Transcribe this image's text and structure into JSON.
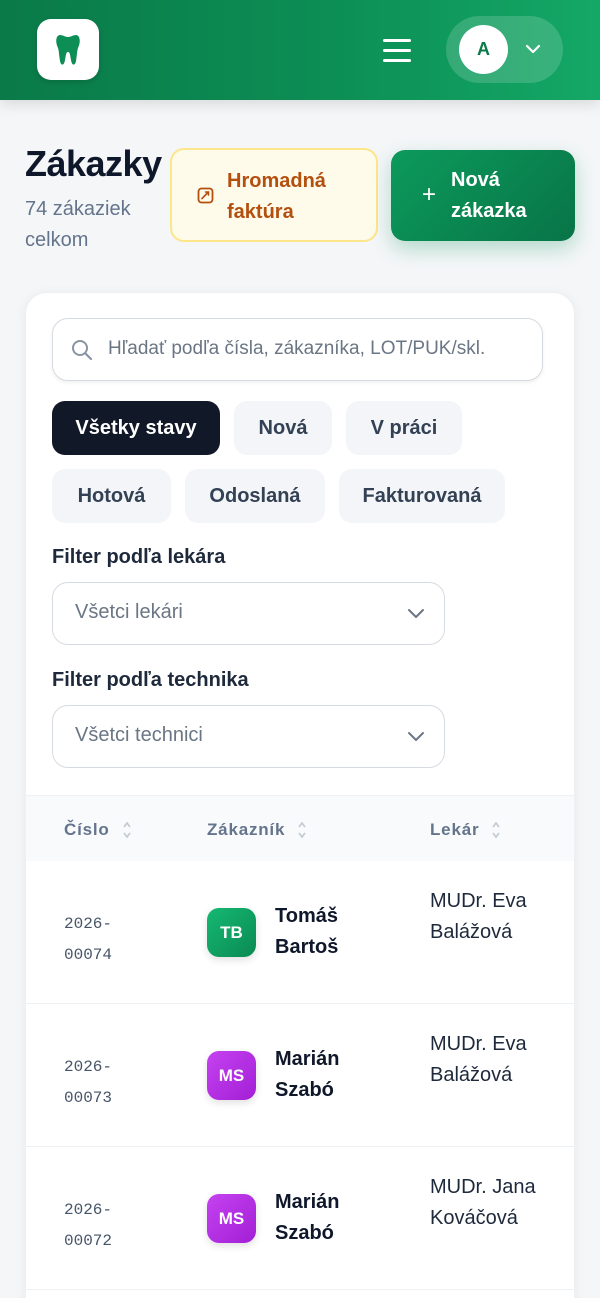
{
  "header": {
    "user_initial": "A",
    "brand_color": "#0c8e55"
  },
  "page": {
    "title": "Zákazky",
    "subtitle": "74 zákaziek celkom",
    "bulk_invoice_label": "Hromadná faktúra",
    "new_order_label": "Nová zákazka",
    "new_order_icon": "plus-icon",
    "bulk_invoice_icon": "invoice-icon"
  },
  "search": {
    "placeholder": "Hľadať podľa čísla, zákazníka, LOT/PUK/skl.",
    "value": ""
  },
  "status_filters": [
    {
      "label": "Všetky stavy",
      "active": true
    },
    {
      "label": "Nová",
      "active": false
    },
    {
      "label": "V práci",
      "active": false
    },
    {
      "label": "Hotová",
      "active": false
    },
    {
      "label": "Odoslaná",
      "active": false
    },
    {
      "label": "Fakturovaná",
      "active": false
    }
  ],
  "doctor_filter": {
    "label": "Filter podľa lekára",
    "value": "Všetci lekári"
  },
  "technician_filter": {
    "label": "Filter podľa technika",
    "value": "Všetci technici"
  },
  "table": {
    "columns": [
      "Číslo",
      "Zákazník",
      "Lekár"
    ],
    "rows": [
      {
        "number": "2026-00074",
        "number_l1": "2026-",
        "number_l2": "00074",
        "initials": "TB",
        "customer": "Tomáš Bartoš",
        "doctor": "MUDr. Eva Balážová",
        "avatar_color": "#10a866"
      },
      {
        "number": "2026-00073",
        "number_l1": "2026-",
        "number_l2": "00073",
        "initials": "MS",
        "customer": "Marián Szabó",
        "doctor": "MUDr. Eva Balážová",
        "avatar_color": "#b62ee6"
      },
      {
        "number": "2026-00072",
        "number_l1": "2026-",
        "number_l2": "00072",
        "initials": "MS",
        "customer": "Marián Szabó",
        "doctor": "MUDr. Jana Kováčová",
        "avatar_color": "#b62ee6"
      }
    ]
  }
}
